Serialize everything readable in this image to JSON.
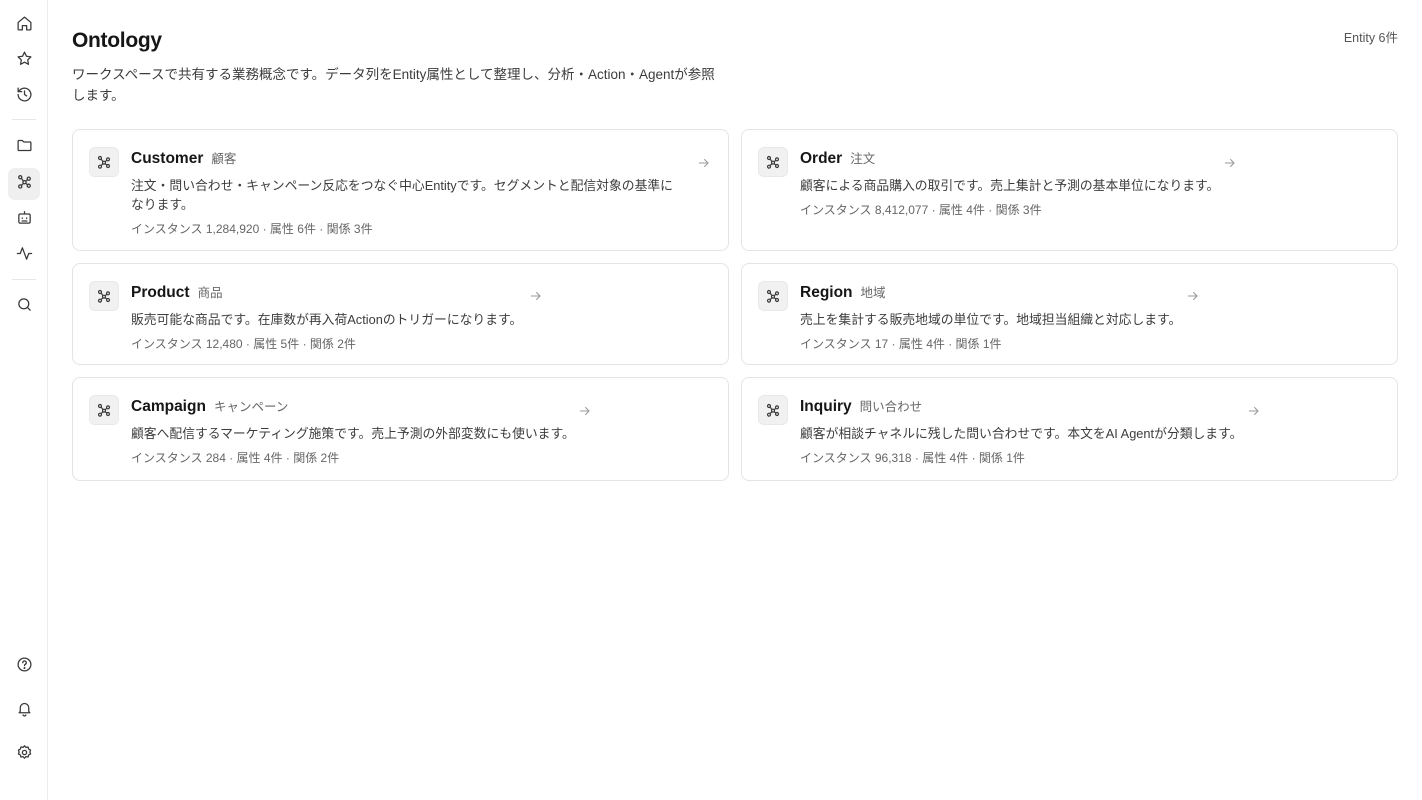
{
  "sidebar": {
    "items": [
      {
        "name": "home",
        "icon": "home-icon"
      },
      {
        "name": "favorites",
        "icon": "star-icon"
      },
      {
        "name": "history",
        "icon": "history-icon"
      },
      {
        "name": "folders",
        "icon": "folder-icon"
      },
      {
        "name": "ontology",
        "icon": "graph-icon",
        "active": true
      },
      {
        "name": "agents",
        "icon": "robot-icon"
      },
      {
        "name": "activity",
        "icon": "activity-icon"
      },
      {
        "name": "search",
        "icon": "search-icon"
      },
      {
        "name": "help",
        "icon": "help-icon"
      },
      {
        "name": "notifications",
        "icon": "bell-icon"
      },
      {
        "name": "settings",
        "icon": "gear-icon"
      }
    ]
  },
  "header": {
    "title": "Ontology",
    "entity_count": "Entity 6件",
    "description": "ワークスペースで共有する業務概念です。データ列をEntity属性として整理し、分析・Action・Agentが参照します。"
  },
  "entities": [
    {
      "name": "Customer",
      "jp": "顧客",
      "desc": "注文・問い合わせ・キャンペーン反応をつなぐ中心Entityです。セグメントと配信対象の基準になります。",
      "meta": "インスタンス 1,284,920 · 属性 6件 · 関係 3件"
    },
    {
      "name": "Order",
      "jp": "注文",
      "desc": "顧客による商品購入の取引です。売上集計と予測の基本単位になります。",
      "meta": "インスタンス 8,412,077 · 属性 4件 · 関係 3件"
    },
    {
      "name": "Product",
      "jp": "商品",
      "desc": "販売可能な商品です。在庫数が再入荷Actionのトリガーになります。",
      "meta": "インスタンス 12,480 · 属性 5件 · 関係 2件"
    },
    {
      "name": "Region",
      "jp": "地域",
      "desc": "売上を集計する販売地域の単位です。地域担当組織と対応します。",
      "meta": "インスタンス 17 · 属性 4件 · 関係 1件"
    },
    {
      "name": "Campaign",
      "jp": "キャンペーン",
      "desc": "顧客へ配信するマーケティング施策です。売上予測の外部変数にも使います。",
      "meta": "インスタンス 284 · 属性 4件 · 関係 2件"
    },
    {
      "name": "Inquiry",
      "jp": "問い合わせ",
      "desc": "顧客が相談チャネルに残した問い合わせです。本文をAI Agentが分類します。",
      "meta": "インスタンス 96,318 · 属性 4件 · 関係 1件"
    }
  ]
}
